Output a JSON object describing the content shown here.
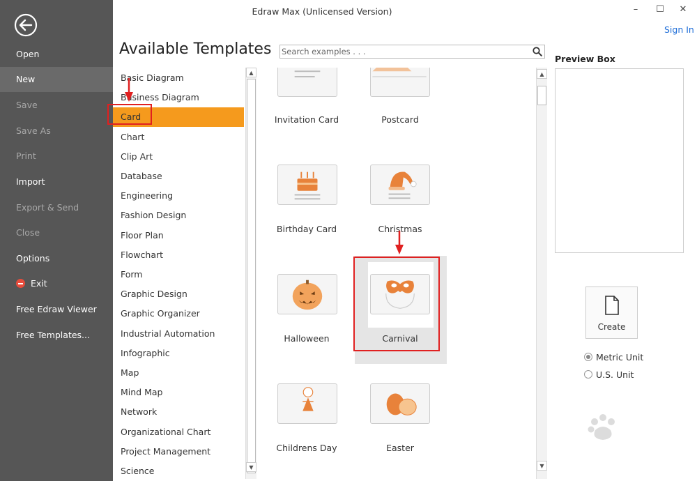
{
  "window": {
    "title": "Edraw Max (Unlicensed Version)",
    "sign_in": "Sign In",
    "minimize": "–",
    "maximize": "☐",
    "close": "✕"
  },
  "file_menu": {
    "items": [
      {
        "label": "Open",
        "state": "normal"
      },
      {
        "label": "New",
        "state": "selected"
      },
      {
        "label": "Save",
        "state": "disabled"
      },
      {
        "label": "Save As",
        "state": "disabled"
      },
      {
        "label": "Print",
        "state": "disabled"
      },
      {
        "label": "Import",
        "state": "normal"
      },
      {
        "label": "Export & Send",
        "state": "disabled"
      },
      {
        "label": "Close",
        "state": "disabled"
      },
      {
        "label": "Options",
        "state": "normal"
      },
      {
        "label": "Exit",
        "state": "normal",
        "icon": "exit-icon"
      },
      {
        "label": "Free Edraw Viewer",
        "state": "normal"
      },
      {
        "label": "Free Templates...",
        "state": "normal"
      }
    ]
  },
  "main": {
    "title": "Available Templates",
    "search": {
      "placeholder": "Search examples . . .",
      "value": ""
    }
  },
  "categories": {
    "selected": "Card",
    "items": [
      "Basic Diagram",
      "Business Diagram",
      "Card",
      "Chart",
      "Clip Art",
      "Database",
      "Engineering",
      "Fashion Design",
      "Floor Plan",
      "Flowchart",
      "Form",
      "Graphic Design",
      "Graphic Organizer",
      "Industrial Automation",
      "Infographic",
      "Map",
      "Mind Map",
      "Network",
      "Organizational Chart",
      "Project Management",
      "Science"
    ]
  },
  "templates": {
    "selected": "Carnival",
    "items": [
      {
        "label": "Invitation Card",
        "icon": "invitation-card-icon"
      },
      {
        "label": "Postcard",
        "icon": "postcard-icon"
      },
      {
        "label": "Birthday Card",
        "icon": "birthday-cake-icon"
      },
      {
        "label": "Christmas",
        "icon": "santa-hat-icon"
      },
      {
        "label": "Halloween",
        "icon": "pumpkin-icon"
      },
      {
        "label": "Carnival",
        "icon": "carnival-mask-icon"
      },
      {
        "label": "Childrens Day",
        "icon": "child-icon"
      },
      {
        "label": "Easter",
        "icon": "easter-eggs-icon"
      }
    ]
  },
  "preview": {
    "title": "Preview Box",
    "create_label": "Create",
    "units": [
      {
        "label": "Metric Unit",
        "checked": true
      },
      {
        "label": "U.S. Unit",
        "checked": false
      }
    ]
  },
  "colors": {
    "accent": "#f59a1d",
    "menu_bg": "#565656",
    "annotation": "#e02020",
    "link": "#1f6ed8"
  }
}
